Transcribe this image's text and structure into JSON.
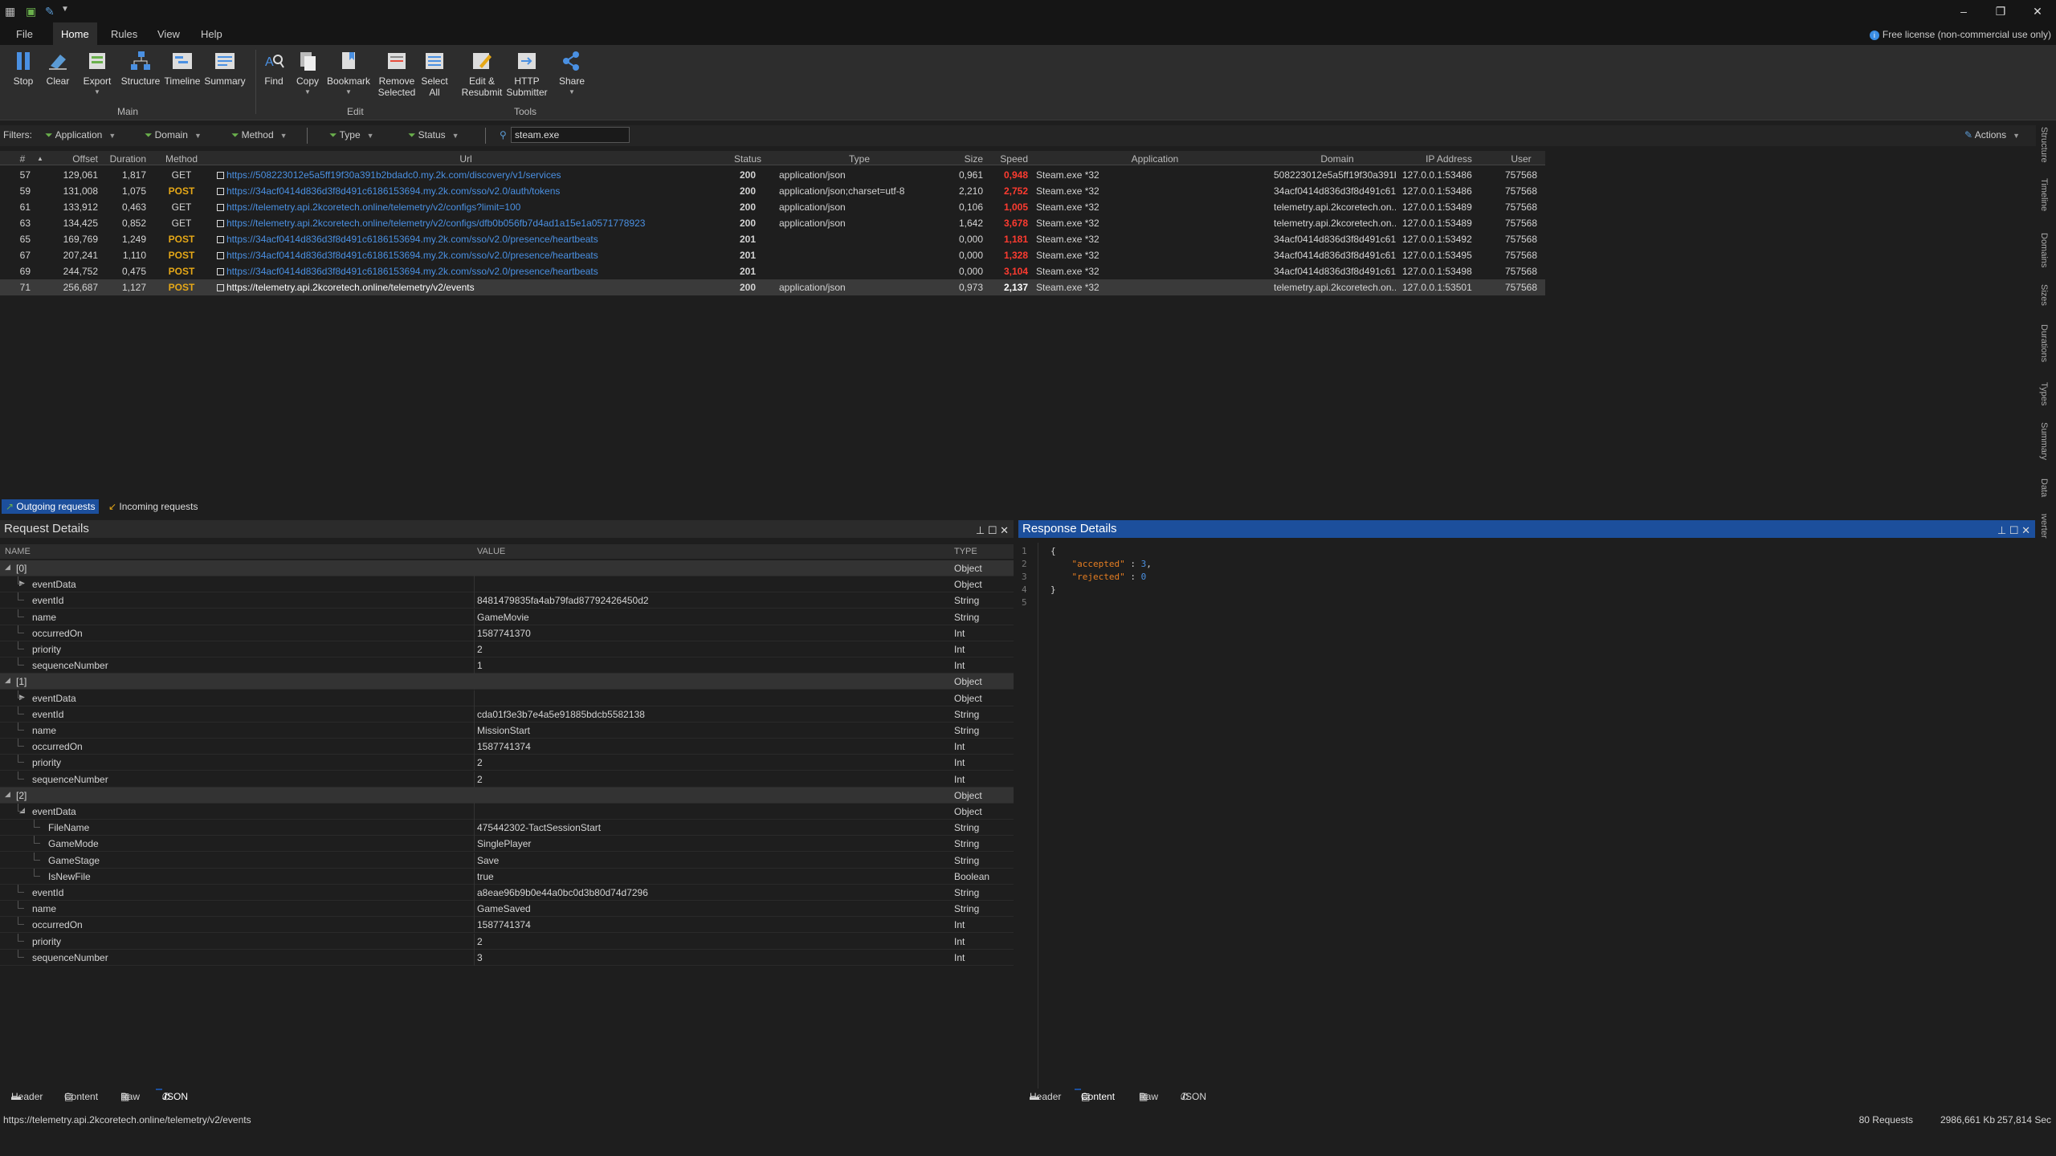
{
  "titlebar": {
    "win_controls": [
      "–",
      "❐",
      "✕"
    ]
  },
  "menu": [
    "File",
    "Home",
    "Rules",
    "View",
    "Help"
  ],
  "license": "Free license (non-commercial use only)",
  "ribbon": {
    "buttons": [
      "Stop",
      "Clear",
      "Export",
      "Structure",
      "Timeline",
      "Summary",
      "Find",
      "Copy",
      "Bookmark",
      "Remove Selected",
      "Select All",
      "Edit & Resubmit",
      "HTTP Submitter",
      "Share"
    ],
    "groups": [
      "Main",
      "Edit",
      "Tools"
    ]
  },
  "filters": {
    "label": "Filters:",
    "items": [
      "Application",
      "Domain",
      "Method",
      "Type",
      "Status"
    ],
    "search": "steam.exe",
    "actions": "Actions"
  },
  "grid": {
    "columns": [
      "#",
      "Offset",
      "Duration",
      "Method",
      "Url",
      "Status",
      "Type",
      "Size",
      "Speed",
      "Application",
      "Domain",
      "IP Address",
      "User"
    ],
    "rows": [
      {
        "num": "57",
        "offset": "129,061",
        "duration": "1,817",
        "method": "GET",
        "url": "https://508223012e5a5ff19f30a391b2bdadc0.my.2k.com/discovery/v1/services",
        "status": "200",
        "type": "application/json",
        "size": "0,961",
        "speed": "0,948",
        "app": "Steam.exe *32",
        "domain": "508223012e5a5ff19f30a391b...",
        "ip": "127.0.0.1:53486",
        "user": "757568"
      },
      {
        "num": "59",
        "offset": "131,008",
        "duration": "1,075",
        "method": "POST",
        "url": "https://34acf0414d836d3f8d491c6186153694.my.2k.com/sso/v2.0/auth/tokens",
        "status": "200",
        "type": "application/json;charset=utf-8",
        "size": "2,210",
        "speed": "2,752",
        "app": "Steam.exe *32",
        "domain": "34acf0414d836d3f8d491c61...",
        "ip": "127.0.0.1:53486",
        "user": "757568"
      },
      {
        "num": "61",
        "offset": "133,912",
        "duration": "0,463",
        "method": "GET",
        "url": "https://telemetry.api.2kcoretech.online/telemetry/v2/configs?limit=100",
        "status": "200",
        "type": "application/json",
        "size": "0,106",
        "speed": "1,005",
        "app": "Steam.exe *32",
        "domain": "telemetry.api.2kcoretech.on...",
        "ip": "127.0.0.1:53489",
        "user": "757568"
      },
      {
        "num": "63",
        "offset": "134,425",
        "duration": "0,852",
        "method": "GET",
        "url": "https://telemetry.api.2kcoretech.online/telemetry/v2/configs/dfb0b056fb7d4ad1a15e1a0571778923",
        "status": "200",
        "type": "application/json",
        "size": "1,642",
        "speed": "3,678",
        "app": "Steam.exe *32",
        "domain": "telemetry.api.2kcoretech.on...",
        "ip": "127.0.0.1:53489",
        "user": "757568"
      },
      {
        "num": "65",
        "offset": "169,769",
        "duration": "1,249",
        "method": "POST",
        "url": "https://34acf0414d836d3f8d491c6186153694.my.2k.com/sso/v2.0/presence/heartbeats",
        "status": "201",
        "type": "",
        "size": "0,000",
        "speed": "1,181",
        "app": "Steam.exe *32",
        "domain": "34acf0414d836d3f8d491c61...",
        "ip": "127.0.0.1:53492",
        "user": "757568"
      },
      {
        "num": "67",
        "offset": "207,241",
        "duration": "1,110",
        "method": "POST",
        "url": "https://34acf0414d836d3f8d491c6186153694.my.2k.com/sso/v2.0/presence/heartbeats",
        "status": "201",
        "type": "",
        "size": "0,000",
        "speed": "1,328",
        "app": "Steam.exe *32",
        "domain": "34acf0414d836d3f8d491c61...",
        "ip": "127.0.0.1:53495",
        "user": "757568"
      },
      {
        "num": "69",
        "offset": "244,752",
        "duration": "0,475",
        "method": "POST",
        "url": "https://34acf0414d836d3f8d491c6186153694.my.2k.com/sso/v2.0/presence/heartbeats",
        "status": "201",
        "type": "",
        "size": "0,000",
        "speed": "3,104",
        "app": "Steam.exe *32",
        "domain": "34acf0414d836d3f8d491c61...",
        "ip": "127.0.0.1:53498",
        "user": "757568"
      },
      {
        "num": "71",
        "offset": "256,687",
        "duration": "1,127",
        "method": "POST",
        "url": "https://telemetry.api.2kcoretech.online/telemetry/v2/events",
        "status": "200",
        "type": "application/json",
        "size": "0,973",
        "speed": "2,137",
        "app": "Steam.exe *32",
        "domain": "telemetry.api.2kcoretech.on...",
        "ip": "127.0.0.1:53501",
        "user": "757568"
      }
    ]
  },
  "sidebar": [
    "Structure",
    "Timeline",
    "Domains",
    "Sizes",
    "Durations",
    "Types",
    "Summary",
    "Data Converter"
  ],
  "req_tabs": [
    "Outgoing requests",
    "Incoming requests"
  ],
  "request": {
    "title": "Request Details",
    "columns": [
      "NAME",
      "VALUE",
      "TYPE"
    ],
    "rows": [
      {
        "name": "[0]",
        "value": "",
        "type": "Object",
        "indent": 0,
        "tw": "◢"
      },
      {
        "name": "eventData",
        "value": "",
        "type": "Object",
        "indent": 1,
        "tw": "▶"
      },
      {
        "name": "eventId",
        "value": "8481479835fa4ab79fad87792426450d2",
        "type": "String",
        "indent": 1,
        "tw": ""
      },
      {
        "name": "name",
        "value": "GameMovie",
        "type": "String",
        "indent": 1,
        "tw": ""
      },
      {
        "name": "occurredOn",
        "value": "1587741370",
        "type": "Int",
        "indent": 1,
        "tw": ""
      },
      {
        "name": "priority",
        "value": "2",
        "type": "Int",
        "indent": 1,
        "tw": ""
      },
      {
        "name": "sequenceNumber",
        "value": "1",
        "type": "Int",
        "indent": 1,
        "tw": ""
      },
      {
        "name": "[1]",
        "value": "",
        "type": "Object",
        "indent": 0,
        "tw": "◢"
      },
      {
        "name": "eventData",
        "value": "",
        "type": "Object",
        "indent": 1,
        "tw": "▶"
      },
      {
        "name": "eventId",
        "value": "cda01f3e3b7e4a5e91885bdcb5582138",
        "type": "String",
        "indent": 1,
        "tw": ""
      },
      {
        "name": "name",
        "value": "MissionStart",
        "type": "String",
        "indent": 1,
        "tw": ""
      },
      {
        "name": "occurredOn",
        "value": "1587741374",
        "type": "Int",
        "indent": 1,
        "tw": ""
      },
      {
        "name": "priority",
        "value": "2",
        "type": "Int",
        "indent": 1,
        "tw": ""
      },
      {
        "name": "sequenceNumber",
        "value": "2",
        "type": "Int",
        "indent": 1,
        "tw": ""
      },
      {
        "name": "[2]",
        "value": "",
        "type": "Object",
        "indent": 0,
        "tw": "◢"
      },
      {
        "name": "eventData",
        "value": "",
        "type": "Object",
        "indent": 1,
        "tw": "◢"
      },
      {
        "name": "FileName",
        "value": "475442302-TactSessionStart",
        "type": "String",
        "indent": 2,
        "tw": ""
      },
      {
        "name": "GameMode",
        "value": "SinglePlayer",
        "type": "String",
        "indent": 2,
        "tw": ""
      },
      {
        "name": "GameStage",
        "value": "Save",
        "type": "String",
        "indent": 2,
        "tw": ""
      },
      {
        "name": "IsNewFile",
        "value": "true",
        "type": "Boolean",
        "indent": 2,
        "tw": ""
      },
      {
        "name": "eventId",
        "value": "a8eae96b9b0e44a0bc0d3b80d74d7296",
        "type": "String",
        "indent": 1,
        "tw": ""
      },
      {
        "name": "name",
        "value": "GameSaved",
        "type": "String",
        "indent": 1,
        "tw": ""
      },
      {
        "name": "occurredOn",
        "value": "1587741374",
        "type": "Int",
        "indent": 1,
        "tw": ""
      },
      {
        "name": "priority",
        "value": "2",
        "type": "Int",
        "indent": 1,
        "tw": ""
      },
      {
        "name": "sequenceNumber",
        "value": "3",
        "type": "Int",
        "indent": 1,
        "tw": ""
      }
    ]
  },
  "response": {
    "title": "Response Details",
    "line_numbers": [
      "1",
      "2",
      "3",
      "4",
      "5"
    ],
    "lines": [
      [
        {
          "t": "{",
          "c": ""
        }
      ],
      [
        {
          "t": "    ",
          "c": ""
        },
        {
          "t": "\"accepted\"",
          "c": "jkey"
        },
        {
          "t": " : ",
          "c": ""
        },
        {
          "t": "3",
          "c": "jnum"
        },
        {
          "t": ",",
          "c": ""
        }
      ],
      [
        {
          "t": "    ",
          "c": ""
        },
        {
          "t": "\"rejected\"",
          "c": "jkey"
        },
        {
          "t": " : ",
          "c": ""
        },
        {
          "t": "0",
          "c": "jnum"
        }
      ],
      [
        {
          "t": "}",
          "c": ""
        }
      ],
      [
        {
          "t": "",
          "c": ""
        }
      ]
    ]
  },
  "bottom_tabs": [
    "Header",
    "Content",
    "Raw",
    "JSON"
  ],
  "status": {
    "url": "https://telemetry.api.2kcoretech.online/telemetry/v2/events",
    "requests": "80 Requests",
    "size": "2986,661 Kb",
    "time": "257,814 Sec"
  }
}
